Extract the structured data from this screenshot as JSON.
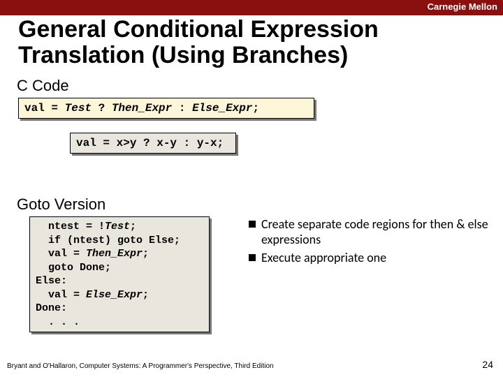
{
  "header": {
    "university": "Carnegie Mellon"
  },
  "title": "General Conditional Expression Translation (Using Branches)",
  "sections": {
    "c_code": "C Code",
    "goto": "Goto Version"
  },
  "code": {
    "generic": {
      "p1": "val = ",
      "p2": "Test",
      "p3": " ? ",
      "p4": "Then_Expr",
      "p5": " : ",
      "p6": "Else_Expr",
      "p7": ";"
    },
    "example": "val = x>y ? x-y : y-x;",
    "goto": {
      "l1a": "  ntest = !",
      "l1b": "Test",
      "l1c": ";",
      "l2": "  if (ntest) goto Else;",
      "l3a": "  val = ",
      "l3b": "Then_Expr",
      "l3c": ";",
      "l4": "  goto Done;",
      "l5": "Else:",
      "l6a": "  val = ",
      "l6b": "Else_Expr",
      "l6c": ";",
      "l7": "Done:",
      "l8": "  . . ."
    }
  },
  "bullets": {
    "b1": "Create separate code regions for then & else expressions",
    "b2": "Execute appropriate one"
  },
  "footer": {
    "attribution": "Bryant and O'Hallaron, Computer Systems: A Programmer's Perspective, Third Edition",
    "page": "24"
  }
}
